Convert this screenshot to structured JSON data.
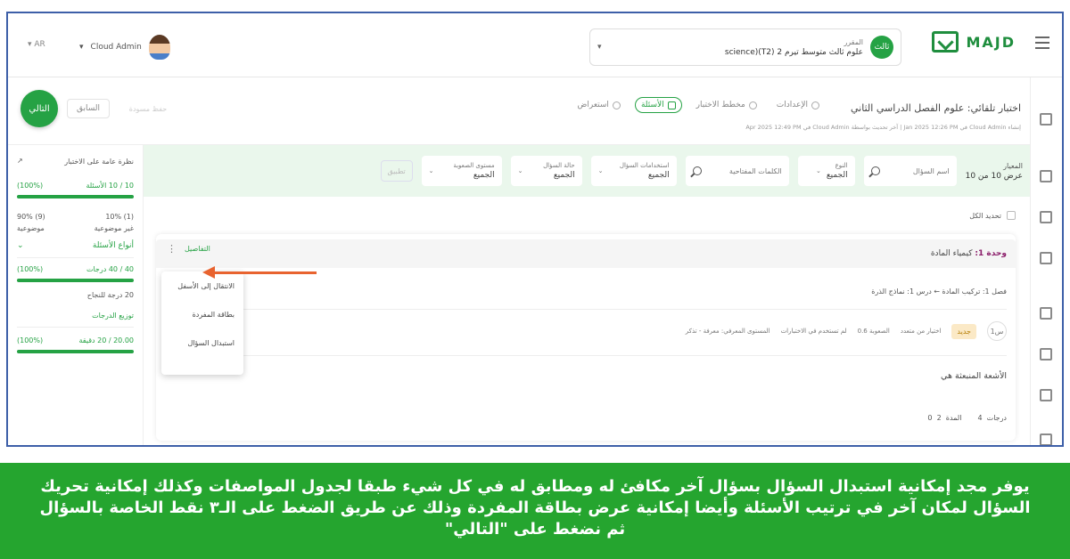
{
  "topbar": {
    "logo": "MAJD",
    "course_label": "المقرر",
    "course_value": "علوم ثالث متوسط تيرم 2 (T2)(science",
    "course_badge": "ثالث",
    "user_name": "Cloud Admin",
    "lang": "AR"
  },
  "exam": {
    "title": "اختبار تلقائي: علوم الفصل الدراسي الثاني",
    "subtitle": "إنشاء Cloud Admin في Jan 2025 12:26 PM | آخر تحديث بواسطة Cloud Admin في Apr 2025 12:49 PM",
    "steps": [
      "الإعدادات",
      "مخطط الاختبار",
      "الأسئلة",
      "استعراض"
    ],
    "next_label": "التالي",
    "prev_label": "السابق",
    "save_label": "حفظ مسودة"
  },
  "sidebar": {
    "title": "نظرة عامة على الاختبار",
    "questions_count": "10 / 10 الأسئلة",
    "questions_pct": "(100%)",
    "objective_pct": "(9) 90%",
    "objective_label": "موضوعية",
    "nonobjective_pct": "(1) 10%",
    "nonobjective_label": "غير موضوعية",
    "question_types": "أنواع الأسئلة",
    "grades": "40 / 40 درجات",
    "grades_pct": "(100%)",
    "pass_grade": "20 درجة للنجاح",
    "grade_dist": "توزيع الدرجات",
    "time": "20.00 / 20 دقيقة",
    "time_pct": "(100%)"
  },
  "filters": {
    "count_label": "المعيار",
    "count_value": "عرض 10 من 10",
    "search_placeholder": "اسم السؤال",
    "type_label": "النوع",
    "type_value": "الجميع",
    "keywords_placeholder": "الكلمات المفتاحية",
    "usage_label": "استخدامات السؤال",
    "usage_value": "الجميع",
    "status_label": "حالة السؤال",
    "status_value": "الجميع",
    "difficulty_label": "مستوى الصعوبة",
    "difficulty_value": "الجميع",
    "apply": "تطبيق"
  },
  "select_all": "تحديد الكل",
  "card": {
    "unit_prefix": "وحدة 1:",
    "unit_name": "كيمياء المادة",
    "details": "التفاصيل",
    "breadcrumb": "فصل 1: تركيب المادة ← درس 1: نماذج الذرة",
    "qnum": "1",
    "q_label": "س",
    "tag": "جديد",
    "qtype": "اختيار من متعدد",
    "difficulty": "الصعوبة 0.6",
    "usage": "لم تستخدم في الاختبارات",
    "level": "المستوى المعرفي: معرفة - تذكر",
    "question_text": "الأشعة المنبعثة هي",
    "grades_label": "درجات",
    "grades_value": "4",
    "duration_label": "المدة",
    "duration_value": "2",
    "zero": "0"
  },
  "popup": {
    "items": [
      "الانتقال إلى الأسفل",
      "بطاقة المفردة",
      "استبدال السؤال"
    ]
  },
  "caption": {
    "text": "يوفر مجد إمكانية استبدال السؤال بسؤال آخر مكافئ له ومطابق له في كل شيء طبقا لجدول المواصفات وكذلك إمكانية تحريك السؤال لمكان آخر في ترتيب الأسئلة وأيضا إمكانية عرض بطاقة المفردة وذلك عن طريق الضغط على الـ٣ نقط الخاصة بالسؤال ثم نضغط على \"التالي\""
  },
  "colors": {
    "brand_green": "#25a244",
    "arrow": "#e8632f",
    "frame_border": "#3d5fa8",
    "caption_bg": "#25a52f"
  }
}
